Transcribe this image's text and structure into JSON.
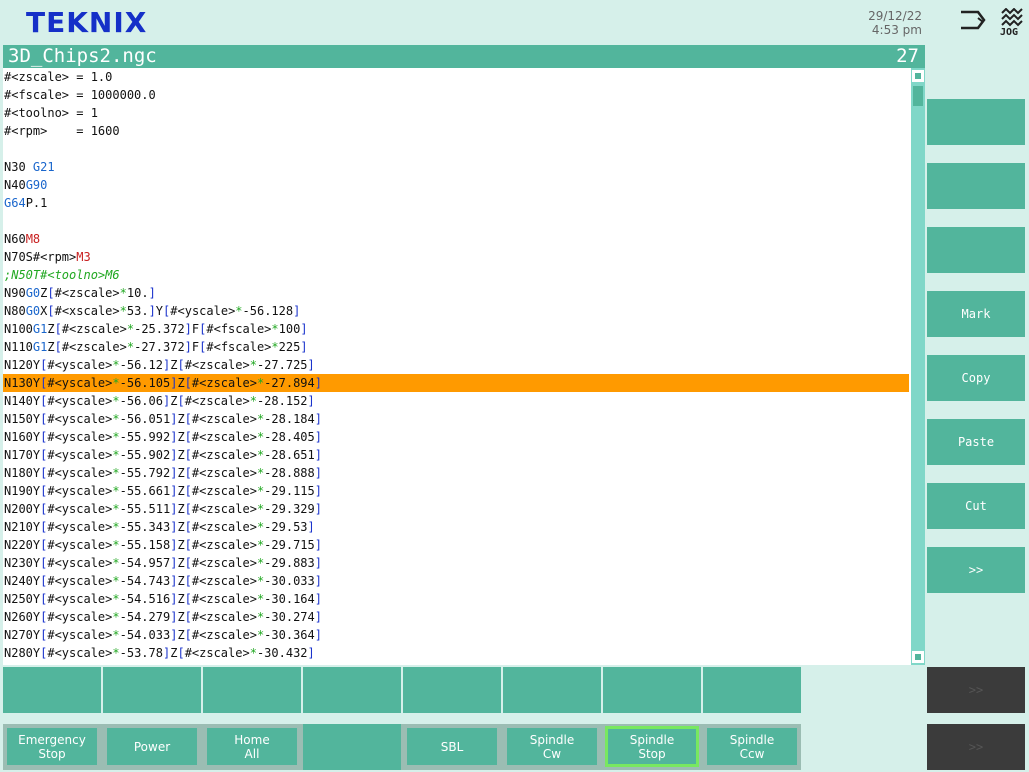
{
  "header": {
    "logo": "TEKNIX",
    "date": "29/12/22",
    "time": "4:53 pm",
    "jog_label": "JOG",
    "icons": [
      "exit-icon",
      "jog-icon"
    ]
  },
  "file": {
    "name": "3D_Chips2.ngc",
    "line_number": "27"
  },
  "editor": {
    "selected_line": "N130Y[#<yscale>*-56.105]Z[#<zscale>*-27.894]",
    "lines": [
      [
        [
          "n",
          "#<zscale> = 1.0"
        ]
      ],
      [
        [
          "n",
          "#<fscale> = 1000000.0"
        ]
      ],
      [
        [
          "n",
          "#<toolno> = 1"
        ]
      ],
      [
        [
          "n",
          "#<rpm>    = 1600"
        ]
      ],
      [
        [
          "n",
          ""
        ]
      ],
      [
        [
          "n",
          "N30 "
        ],
        [
          "g",
          "G21"
        ]
      ],
      [
        [
          "n",
          "N40"
        ],
        [
          "g",
          "G90"
        ]
      ],
      [
        [
          "g",
          "G64"
        ],
        [
          "n",
          "P.1"
        ]
      ],
      [
        [
          "n",
          ""
        ]
      ],
      [
        [
          "n",
          "N60"
        ],
        [
          "m",
          "M8"
        ]
      ],
      [
        [
          "n",
          "N70S#<rpm>"
        ],
        [
          "m",
          "M3"
        ]
      ],
      [
        [
          "c",
          ";N50T#<toolno>M6"
        ]
      ],
      [
        [
          "n",
          "N90"
        ],
        [
          "g",
          "G0"
        ],
        [
          "n",
          "Z"
        ],
        [
          "b",
          "["
        ],
        [
          "n",
          "#<zscale>"
        ],
        [
          "o",
          "*"
        ],
        [
          "n",
          "10."
        ],
        [
          "b",
          "]"
        ]
      ],
      [
        [
          "n",
          "N80"
        ],
        [
          "g",
          "G0"
        ],
        [
          "n",
          "X"
        ],
        [
          "b",
          "["
        ],
        [
          "n",
          "#<xscale>"
        ],
        [
          "o",
          "*"
        ],
        [
          "n",
          "53."
        ],
        [
          "b",
          "]"
        ],
        [
          "n",
          "Y"
        ],
        [
          "b",
          "["
        ],
        [
          "n",
          "#<yscale>"
        ],
        [
          "o",
          "*"
        ],
        [
          "n",
          "-56.128"
        ],
        [
          "b",
          "]"
        ]
      ],
      [
        [
          "n",
          "N100"
        ],
        [
          "g",
          "G1"
        ],
        [
          "n",
          "Z"
        ],
        [
          "b",
          "["
        ],
        [
          "n",
          "#<zscale>"
        ],
        [
          "o",
          "*"
        ],
        [
          "n",
          "-25.372"
        ],
        [
          "b",
          "]"
        ],
        [
          "n",
          "F"
        ],
        [
          "b",
          "["
        ],
        [
          "n",
          "#<fscale>"
        ],
        [
          "o",
          "*"
        ],
        [
          "n",
          "100"
        ],
        [
          "b",
          "]"
        ]
      ],
      [
        [
          "n",
          "N110"
        ],
        [
          "g",
          "G1"
        ],
        [
          "n",
          "Z"
        ],
        [
          "b",
          "["
        ],
        [
          "n",
          "#<zscale>"
        ],
        [
          "o",
          "*"
        ],
        [
          "n",
          "-27.372"
        ],
        [
          "b",
          "]"
        ],
        [
          "n",
          "F"
        ],
        [
          "b",
          "["
        ],
        [
          "n",
          "#<fscale>"
        ],
        [
          "o",
          "*"
        ],
        [
          "n",
          "225"
        ],
        [
          "b",
          "]"
        ]
      ],
      [
        [
          "n",
          "N120Y"
        ],
        [
          "b",
          "["
        ],
        [
          "n",
          "#<yscale>"
        ],
        [
          "o",
          "*"
        ],
        [
          "n",
          "-56.12"
        ],
        [
          "b",
          "]"
        ],
        [
          "n",
          "Z"
        ],
        [
          "b",
          "["
        ],
        [
          "n",
          "#<zscale>"
        ],
        [
          "o",
          "*"
        ],
        [
          "n",
          "-27.725"
        ],
        [
          "b",
          "]"
        ]
      ],
      [
        [
          "n",
          "N130Y"
        ],
        [
          "b",
          "["
        ],
        [
          "n",
          "#<yscale>"
        ],
        [
          "o",
          "*"
        ],
        [
          "n",
          "-56.105"
        ],
        [
          "b",
          "]"
        ],
        [
          "n",
          "Z"
        ],
        [
          "b",
          "["
        ],
        [
          "n",
          "#<zscale>"
        ],
        [
          "o",
          "*"
        ],
        [
          "n",
          "-27.894"
        ],
        [
          "b",
          "]"
        ]
      ],
      [
        [
          "n",
          "N140Y"
        ],
        [
          "b",
          "["
        ],
        [
          "n",
          "#<yscale>"
        ],
        [
          "o",
          "*"
        ],
        [
          "n",
          "-56.06"
        ],
        [
          "b",
          "]"
        ],
        [
          "n",
          "Z"
        ],
        [
          "b",
          "["
        ],
        [
          "n",
          "#<zscale>"
        ],
        [
          "o",
          "*"
        ],
        [
          "n",
          "-28.152"
        ],
        [
          "b",
          "]"
        ]
      ],
      [
        [
          "n",
          "N150Y"
        ],
        [
          "b",
          "["
        ],
        [
          "n",
          "#<yscale>"
        ],
        [
          "o",
          "*"
        ],
        [
          "n",
          "-56.051"
        ],
        [
          "b",
          "]"
        ],
        [
          "n",
          "Z"
        ],
        [
          "b",
          "["
        ],
        [
          "n",
          "#<zscale>"
        ],
        [
          "o",
          "*"
        ],
        [
          "n",
          "-28.184"
        ],
        [
          "b",
          "]"
        ]
      ],
      [
        [
          "n",
          "N160Y"
        ],
        [
          "b",
          "["
        ],
        [
          "n",
          "#<yscale>"
        ],
        [
          "o",
          "*"
        ],
        [
          "n",
          "-55.992"
        ],
        [
          "b",
          "]"
        ],
        [
          "n",
          "Z"
        ],
        [
          "b",
          "["
        ],
        [
          "n",
          "#<zscale>"
        ],
        [
          "o",
          "*"
        ],
        [
          "n",
          "-28.405"
        ],
        [
          "b",
          "]"
        ]
      ],
      [
        [
          "n",
          "N170Y"
        ],
        [
          "b",
          "["
        ],
        [
          "n",
          "#<yscale>"
        ],
        [
          "o",
          "*"
        ],
        [
          "n",
          "-55.902"
        ],
        [
          "b",
          "]"
        ],
        [
          "n",
          "Z"
        ],
        [
          "b",
          "["
        ],
        [
          "n",
          "#<zscale>"
        ],
        [
          "o",
          "*"
        ],
        [
          "n",
          "-28.651"
        ],
        [
          "b",
          "]"
        ]
      ],
      [
        [
          "n",
          "N180Y"
        ],
        [
          "b",
          "["
        ],
        [
          "n",
          "#<yscale>"
        ],
        [
          "o",
          "*"
        ],
        [
          "n",
          "-55.792"
        ],
        [
          "b",
          "]"
        ],
        [
          "n",
          "Z"
        ],
        [
          "b",
          "["
        ],
        [
          "n",
          "#<zscale>"
        ],
        [
          "o",
          "*"
        ],
        [
          "n",
          "-28.888"
        ],
        [
          "b",
          "]"
        ]
      ],
      [
        [
          "n",
          "N190Y"
        ],
        [
          "b",
          "["
        ],
        [
          "n",
          "#<yscale>"
        ],
        [
          "o",
          "*"
        ],
        [
          "n",
          "-55.661"
        ],
        [
          "b",
          "]"
        ],
        [
          "n",
          "Z"
        ],
        [
          "b",
          "["
        ],
        [
          "n",
          "#<zscale>"
        ],
        [
          "o",
          "*"
        ],
        [
          "n",
          "-29.115"
        ],
        [
          "b",
          "]"
        ]
      ],
      [
        [
          "n",
          "N200Y"
        ],
        [
          "b",
          "["
        ],
        [
          "n",
          "#<yscale>"
        ],
        [
          "o",
          "*"
        ],
        [
          "n",
          "-55.511"
        ],
        [
          "b",
          "]"
        ],
        [
          "n",
          "Z"
        ],
        [
          "b",
          "["
        ],
        [
          "n",
          "#<zscale>"
        ],
        [
          "o",
          "*"
        ],
        [
          "n",
          "-29.329"
        ],
        [
          "b",
          "]"
        ]
      ],
      [
        [
          "n",
          "N210Y"
        ],
        [
          "b",
          "["
        ],
        [
          "n",
          "#<yscale>"
        ],
        [
          "o",
          "*"
        ],
        [
          "n",
          "-55.343"
        ],
        [
          "b",
          "]"
        ],
        [
          "n",
          "Z"
        ],
        [
          "b",
          "["
        ],
        [
          "n",
          "#<zscale>"
        ],
        [
          "o",
          "*"
        ],
        [
          "n",
          "-29.53"
        ],
        [
          "b",
          "]"
        ]
      ],
      [
        [
          "n",
          "N220Y"
        ],
        [
          "b",
          "["
        ],
        [
          "n",
          "#<yscale>"
        ],
        [
          "o",
          "*"
        ],
        [
          "n",
          "-55.158"
        ],
        [
          "b",
          "]"
        ],
        [
          "n",
          "Z"
        ],
        [
          "b",
          "["
        ],
        [
          "n",
          "#<zscale>"
        ],
        [
          "o",
          "*"
        ],
        [
          "n",
          "-29.715"
        ],
        [
          "b",
          "]"
        ]
      ],
      [
        [
          "n",
          "N230Y"
        ],
        [
          "b",
          "["
        ],
        [
          "n",
          "#<yscale>"
        ],
        [
          "o",
          "*"
        ],
        [
          "n",
          "-54.957"
        ],
        [
          "b",
          "]"
        ],
        [
          "n",
          "Z"
        ],
        [
          "b",
          "["
        ],
        [
          "n",
          "#<zscale>"
        ],
        [
          "o",
          "*"
        ],
        [
          "n",
          "-29.883"
        ],
        [
          "b",
          "]"
        ]
      ],
      [
        [
          "n",
          "N240Y"
        ],
        [
          "b",
          "["
        ],
        [
          "n",
          "#<yscale>"
        ],
        [
          "o",
          "*"
        ],
        [
          "n",
          "-54.743"
        ],
        [
          "b",
          "]"
        ],
        [
          "n",
          "Z"
        ],
        [
          "b",
          "["
        ],
        [
          "n",
          "#<zscale>"
        ],
        [
          "o",
          "*"
        ],
        [
          "n",
          "-30.033"
        ],
        [
          "b",
          "]"
        ]
      ],
      [
        [
          "n",
          "N250Y"
        ],
        [
          "b",
          "["
        ],
        [
          "n",
          "#<yscale>"
        ],
        [
          "o",
          "*"
        ],
        [
          "n",
          "-54.516"
        ],
        [
          "b",
          "]"
        ],
        [
          "n",
          "Z"
        ],
        [
          "b",
          "["
        ],
        [
          "n",
          "#<zscale>"
        ],
        [
          "o",
          "*"
        ],
        [
          "n",
          "-30.164"
        ],
        [
          "b",
          "]"
        ]
      ],
      [
        [
          "n",
          "N260Y"
        ],
        [
          "b",
          "["
        ],
        [
          "n",
          "#<yscale>"
        ],
        [
          "o",
          "*"
        ],
        [
          "n",
          "-54.279"
        ],
        [
          "b",
          "]"
        ],
        [
          "n",
          "Z"
        ],
        [
          "b",
          "["
        ],
        [
          "n",
          "#<zscale>"
        ],
        [
          "o",
          "*"
        ],
        [
          "n",
          "-30.274"
        ],
        [
          "b",
          "]"
        ]
      ],
      [
        [
          "n",
          "N270Y"
        ],
        [
          "b",
          "["
        ],
        [
          "n",
          "#<yscale>"
        ],
        [
          "o",
          "*"
        ],
        [
          "n",
          "-54.033"
        ],
        [
          "b",
          "]"
        ],
        [
          "n",
          "Z"
        ],
        [
          "b",
          "["
        ],
        [
          "n",
          "#<zscale>"
        ],
        [
          "o",
          "*"
        ],
        [
          "n",
          "-30.364"
        ],
        [
          "b",
          "]"
        ]
      ],
      [
        [
          "n",
          "N280Y"
        ],
        [
          "b",
          "["
        ],
        [
          "n",
          "#<yscale>"
        ],
        [
          "o",
          "*"
        ],
        [
          "n",
          "-53.78"
        ],
        [
          "b",
          "]"
        ],
        [
          "n",
          "Z"
        ],
        [
          "b",
          "["
        ],
        [
          "n",
          "#<zscale>"
        ],
        [
          "o",
          "*"
        ],
        [
          "n",
          "-30.432"
        ],
        [
          "b",
          "]"
        ]
      ]
    ]
  },
  "side_buttons": [
    "",
    "",
    "",
    "Mark",
    "Copy",
    "Paste",
    "Cut",
    ">>"
  ],
  "function_keys": [
    "",
    "",
    "",
    "",
    "",
    "",
    "",
    ""
  ],
  "bottom_buttons": [
    "Emergency\nStop",
    "Power",
    "Home\nAll",
    "",
    "SBL",
    "Spindle\nCw",
    "Spindle\nStop",
    "Spindle\nCcw"
  ],
  "active_bottom_button": "Spindle\nStop",
  "disabled_buttons": [
    ">>",
    ">>"
  ],
  "colors": {
    "accent": "#52b59c",
    "background": "#d6f0ea",
    "highlight": "#ff9a00",
    "logo": "#1530c8",
    "active_outline": "#78e860"
  }
}
